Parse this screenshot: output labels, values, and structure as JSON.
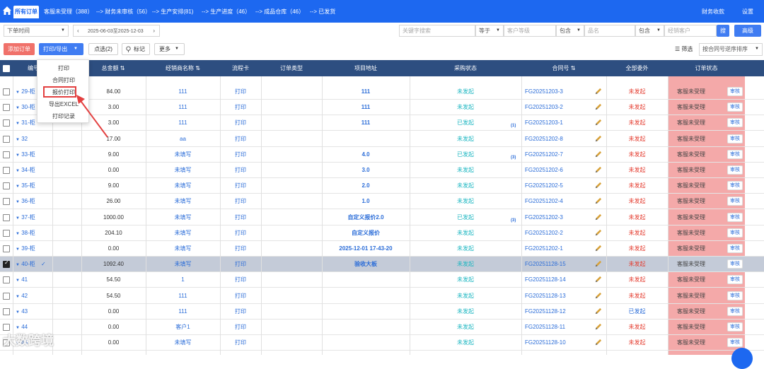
{
  "topnav": {
    "active_tab": "所有订单",
    "steps": [
      "客服未受理（388）",
      "--> 财务未审核（56）",
      "--> 生产安排(81)",
      "--> 生产进度（46）",
      "--> 成品仓库（46）",
      "--> 已发货"
    ],
    "right_links": [
      "财务收款",
      "设置"
    ]
  },
  "filters": {
    "time_type": "下单时间",
    "date_range": "2025-06-03至2025-12-03",
    "keyword_placeholder": "关键字搜索",
    "op1": "等于",
    "level_placeholder": "客户等级",
    "op2": "包含",
    "product_placeholder": "品名",
    "op3": "包含",
    "dealer_placeholder": "经销客户",
    "search_label": "搜",
    "advanced_label": "高级"
  },
  "toolbar": {
    "add_order": "添加订单",
    "print_export": "打印/导出",
    "selected": "点选(2)",
    "mark": "标记",
    "more": "更多",
    "filter": "筛选",
    "sort": "按合同号逆序排序"
  },
  "menu": {
    "items": [
      "打印",
      "合同打印",
      "报价打印",
      "导出EXCEL",
      "打印记录"
    ]
  },
  "table": {
    "headers": {
      "no": "编号",
      "amount": "总金额",
      "dealer": "经销商名称",
      "flow": "流程卡",
      "order_type": "订单类型",
      "addr": "项目地址",
      "purchase": "采购状态",
      "contract": "合同号",
      "outsource": "全部委外",
      "status": "订单状态"
    },
    "rows": [
      {
        "no": "29-柜",
        "amount": "84.00",
        "dealer": "111",
        "flow": "打印",
        "addr": "111",
        "purchase": "未发起",
        "count": "",
        "contract": "FG20251203-3",
        "outsource": "未发起",
        "status": "客服未受理",
        "audit": "审核",
        "checked": false
      },
      {
        "no": "30-柜",
        "amount": "3.00",
        "dealer": "111",
        "flow": "打印",
        "addr": "111",
        "purchase": "未发起",
        "count": "",
        "contract": "FG20251203-2",
        "outsource": "未发起",
        "status": "客服未受理",
        "audit": "审核",
        "checked": false
      },
      {
        "no": "31-柜",
        "amount": "3.00",
        "dealer": "111",
        "flow": "打印",
        "addr": "111",
        "purchase": "已发起",
        "count": "(1)",
        "contract": "FG20251203-1",
        "outsource": "未发起",
        "status": "客服未受理",
        "audit": "审核",
        "checked": false
      },
      {
        "no": "32",
        "amount": "17.00",
        "dealer": "aa",
        "flow": "打印",
        "addr": "",
        "purchase": "未发起",
        "count": "",
        "contract": "FG20251202-8",
        "outsource": "未发起",
        "status": "客服未受理",
        "audit": "审核",
        "checked": false
      },
      {
        "no": "33-柜",
        "amount": "9.00",
        "dealer": "未填写",
        "flow": "打印",
        "addr": "4.0",
        "purchase": "已发起",
        "count": "(3)",
        "contract": "FG20251202-7",
        "outsource": "未发起",
        "status": "客服未受理",
        "audit": "审核",
        "checked": false
      },
      {
        "no": "34-柜",
        "amount": "0.00",
        "dealer": "未填写",
        "flow": "打印",
        "addr": "3.0",
        "purchase": "未发起",
        "count": "",
        "contract": "FG20251202-6",
        "outsource": "未发起",
        "status": "客服未受理",
        "audit": "审核",
        "checked": false
      },
      {
        "no": "35-柜",
        "amount": "9.00",
        "dealer": "未填写",
        "flow": "打印",
        "addr": "2.0",
        "purchase": "未发起",
        "count": "",
        "contract": "FG20251202-5",
        "outsource": "未发起",
        "status": "客服未受理",
        "audit": "审核",
        "checked": false
      },
      {
        "no": "36-柜",
        "amount": "26.00",
        "dealer": "未填写",
        "flow": "打印",
        "addr": "1.0",
        "purchase": "未发起",
        "count": "",
        "contract": "FG20251202-4",
        "outsource": "未发起",
        "status": "客服未受理",
        "audit": "审核",
        "checked": false
      },
      {
        "no": "37-柜",
        "amount": "1000.00",
        "dealer": "未填写",
        "flow": "打印",
        "addr": "自定义报价2.0",
        "purchase": "已发起",
        "count": "(3)",
        "contract": "FG20251202-3",
        "outsource": "未发起",
        "status": "客服未受理",
        "audit": "审核",
        "checked": false
      },
      {
        "no": "38-柜",
        "amount": "204.10",
        "dealer": "未填写",
        "flow": "打印",
        "addr": "自定义报价",
        "purchase": "未发起",
        "count": "",
        "contract": "FG20251202-2",
        "outsource": "未发起",
        "status": "客服未受理",
        "audit": "审核",
        "checked": false
      },
      {
        "no": "39-柜",
        "amount": "0.00",
        "dealer": "未填写",
        "flow": "打印",
        "addr": "2025-12-01 17-43-20",
        "purchase": "未发起",
        "count": "",
        "contract": "FG20251202-1",
        "outsource": "未发起",
        "status": "客服未受理",
        "audit": "审核",
        "checked": false
      },
      {
        "no": "40-柜",
        "amount": "1092.40",
        "dealer": "未填写",
        "flow": "打印",
        "addr": "验收大板",
        "purchase": "未发起",
        "count": "",
        "contract": "FG20251128-15",
        "outsource": "未发起",
        "status": "客服未受理",
        "audit": "审核",
        "checked": true
      },
      {
        "no": "41",
        "amount": "54.50",
        "dealer": "1",
        "flow": "打印",
        "addr": "",
        "purchase": "未发起",
        "count": "",
        "contract": "FG20251128-14",
        "outsource": "未发起",
        "status": "客服未受理",
        "audit": "审核",
        "checked": false
      },
      {
        "no": "42",
        "amount": "54.50",
        "dealer": "111",
        "flow": "打印",
        "addr": "",
        "purchase": "未发起",
        "count": "",
        "contract": "FG20251128-13",
        "outsource": "未发起",
        "status": "客服未受理",
        "audit": "审核",
        "checked": false
      },
      {
        "no": "43",
        "amount": "0.00",
        "dealer": "111",
        "flow": "打印",
        "addr": "",
        "purchase": "未发起",
        "count": "",
        "contract": "FG20251128-12",
        "outsource": "已发起",
        "status": "客服未受理",
        "audit": "审核",
        "checked": false
      },
      {
        "no": "44",
        "amount": "0.00",
        "dealer": "客户1",
        "flow": "打印",
        "addr": "",
        "purchase": "未发起",
        "count": "",
        "contract": "FG20251128-11",
        "outsource": "未发起",
        "status": "客服未受理",
        "audit": "审核",
        "checked": false
      },
      {
        "no": "45",
        "amount": "0.00",
        "dealer": "未填写",
        "flow": "打印",
        "addr": "",
        "purchase": "未发起",
        "count": "",
        "contract": "FG20251128-10",
        "outsource": "未发起",
        "status": "客服未受理",
        "audit": "审核",
        "checked": false
      }
    ]
  },
  "watermark": "大数跨境",
  "colors": {
    "brand": "#1d68f0",
    "header": "#2d4e80",
    "status_bg": "#f4a9a9",
    "add_btn": "#f0716a",
    "alert": "#e43c2f"
  }
}
